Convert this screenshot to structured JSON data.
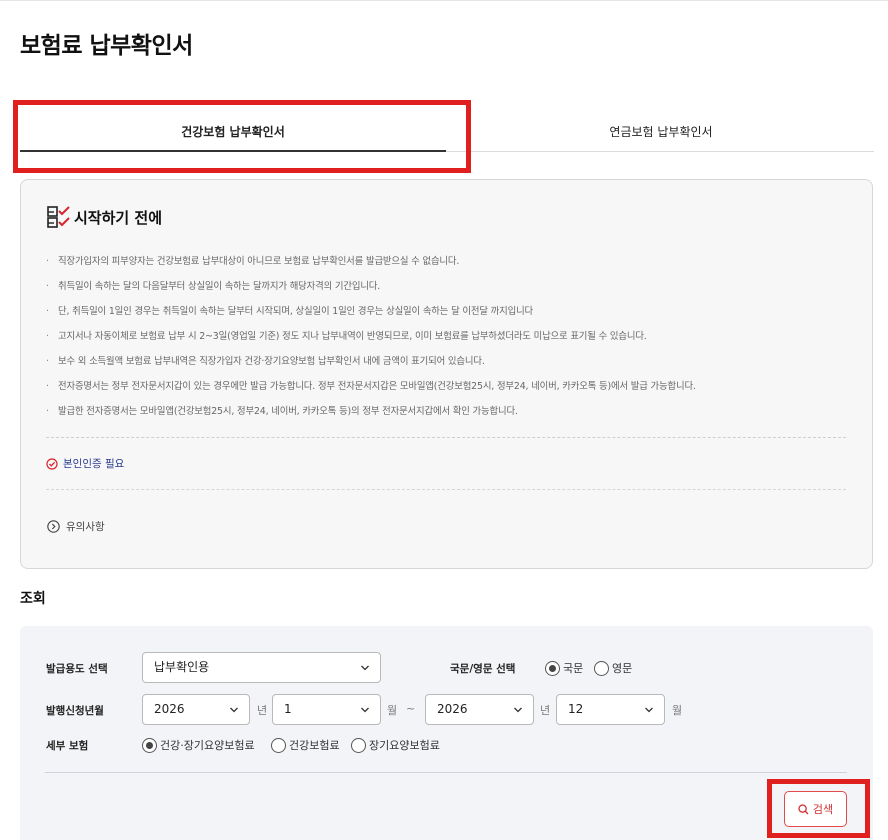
{
  "page": {
    "title": "보험료 납부확인서"
  },
  "tabs": [
    {
      "label": "건강보험 납부확인서",
      "active": true
    },
    {
      "label": "연금보험 납부확인서",
      "active": false
    }
  ],
  "notice": {
    "title": "시작하기 전에",
    "items": [
      "직장가입자의 피부양자는 건강보험료 납부대상이 아니므로 보험료 납부확인서를 발급받으실 수 없습니다.",
      "취득일이 속하는 달의 다음달부터 상실일이 속하는 달까지가 해당자격의 기간입니다.",
      "단, 취득일이 1일인 경우는 취득일이 속하는 달부터 시작되며, 상실일이 1일인 경우는 상실일이 속하는 달 이전달 까지입니다",
      "고지서나 자동이체로 보험료 납부 시 2~3일(영업일 기준) 정도 지나 납부내역이 반영되므로, 이미 보험료를 납부하셨더라도 미납으로 표기될 수 있습니다.",
      "보수 외 소득월액 보험료 납부내역은 직장가입자 건강·장기요양보험 납부확인서 내에 금액이 표기되어 있습니다.",
      "전자증명서는 정부 전자문서지갑이 있는 경우에만 발급 가능합니다. 정부 전자문서지갑은 모바일앱(건강보험25시, 정부24, 네이버, 카카오톡 등)에서 발급 가능합니다.",
      "발급한 전자증명서는 모바일앱(건강보험25시, 정부24, 네이버, 카카오톡 등)의 정부 전자문서지갑에서 확인 가능합니다."
    ],
    "auth_label": "본인인증 필요",
    "caution_label": "유의사항"
  },
  "search": {
    "section_title": "조회",
    "purpose_label": "발급용도 선택",
    "purpose_value": "납부확인용",
    "lang_label": "국문/영문 선택",
    "lang_options": [
      {
        "label": "국문",
        "checked": true
      },
      {
        "label": "영문",
        "checked": false
      }
    ],
    "period_label": "발행신청년월",
    "from_year": "2026",
    "year_unit": "년",
    "from_month": "1",
    "month_unit": "월",
    "tilde": "~",
    "to_year": "2026",
    "to_month": "12",
    "detail_label": "세부 보험",
    "detail_options": [
      {
        "label": "건강·장기요양보험료",
        "checked": true
      },
      {
        "label": "건강보험료",
        "checked": false
      },
      {
        "label": "장기요양보험료",
        "checked": false
      }
    ],
    "search_button": "검색"
  },
  "colors": {
    "highlight": "#e0201f",
    "link": "#2a3b8f",
    "search_accent": "#d13030"
  }
}
